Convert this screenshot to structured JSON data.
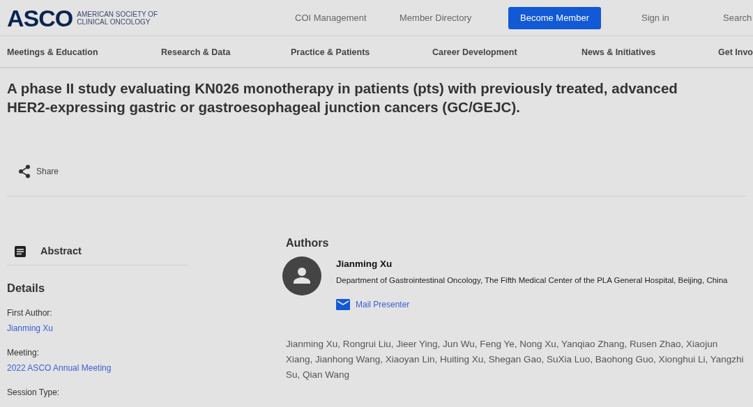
{
  "header": {
    "logo": {
      "mark": "ASCO",
      "name_line_1": "AMERICAN SOCIETY OF",
      "name_line_2": "CLINICAL ONCOLOGY"
    },
    "links": [
      "COI Management",
      "Member Directory"
    ],
    "cta": "Become Member",
    "sign_in": "Sign in",
    "search": "Search"
  },
  "nav": [
    "Meetings & Education",
    "Research & Data",
    "Practice & Patients",
    "Career Development",
    "News & Initiatives",
    "Get Invo"
  ],
  "title": "A phase II study evaluating KN026 monotherapy in patients (pts) with previously treated, advanced HER2-expressing gastric or gastroesophageal junction cancers (GC/GEJC).",
  "share": "Share",
  "sidebar": {
    "abstract": "Abstract",
    "details_heading": "Details",
    "details": [
      {
        "label": "First Author:",
        "value": "Jianming Xu"
      },
      {
        "label": "Meeting:",
        "value": "2022 ASCO Annual Meeting"
      },
      {
        "label": "Session Type:"
      }
    ]
  },
  "authors": {
    "heading": "Authors",
    "presenter": {
      "name": "Jianming Xu",
      "affiliation": "Department of Gastrointestinal Oncology, The Fifth Medical Center of the PLA General Hospital, Beijing, China",
      "mail": "Mail Presenter"
    },
    "list": "Jianming Xu, Rongrui Liu, Jieer Ying, Jun Wu, Feng Ye, Nong Xu, Yanqiao Zhang, Rusen Zhao, Xiaojun Xiang, Jianhong Wang, Xiaoyan Lin, Huiting Xu, Shegan Gao, SuXia Luo, Baohong Guo, Xionghui Li, Yangzhi Su, Qian Wang"
  }
}
